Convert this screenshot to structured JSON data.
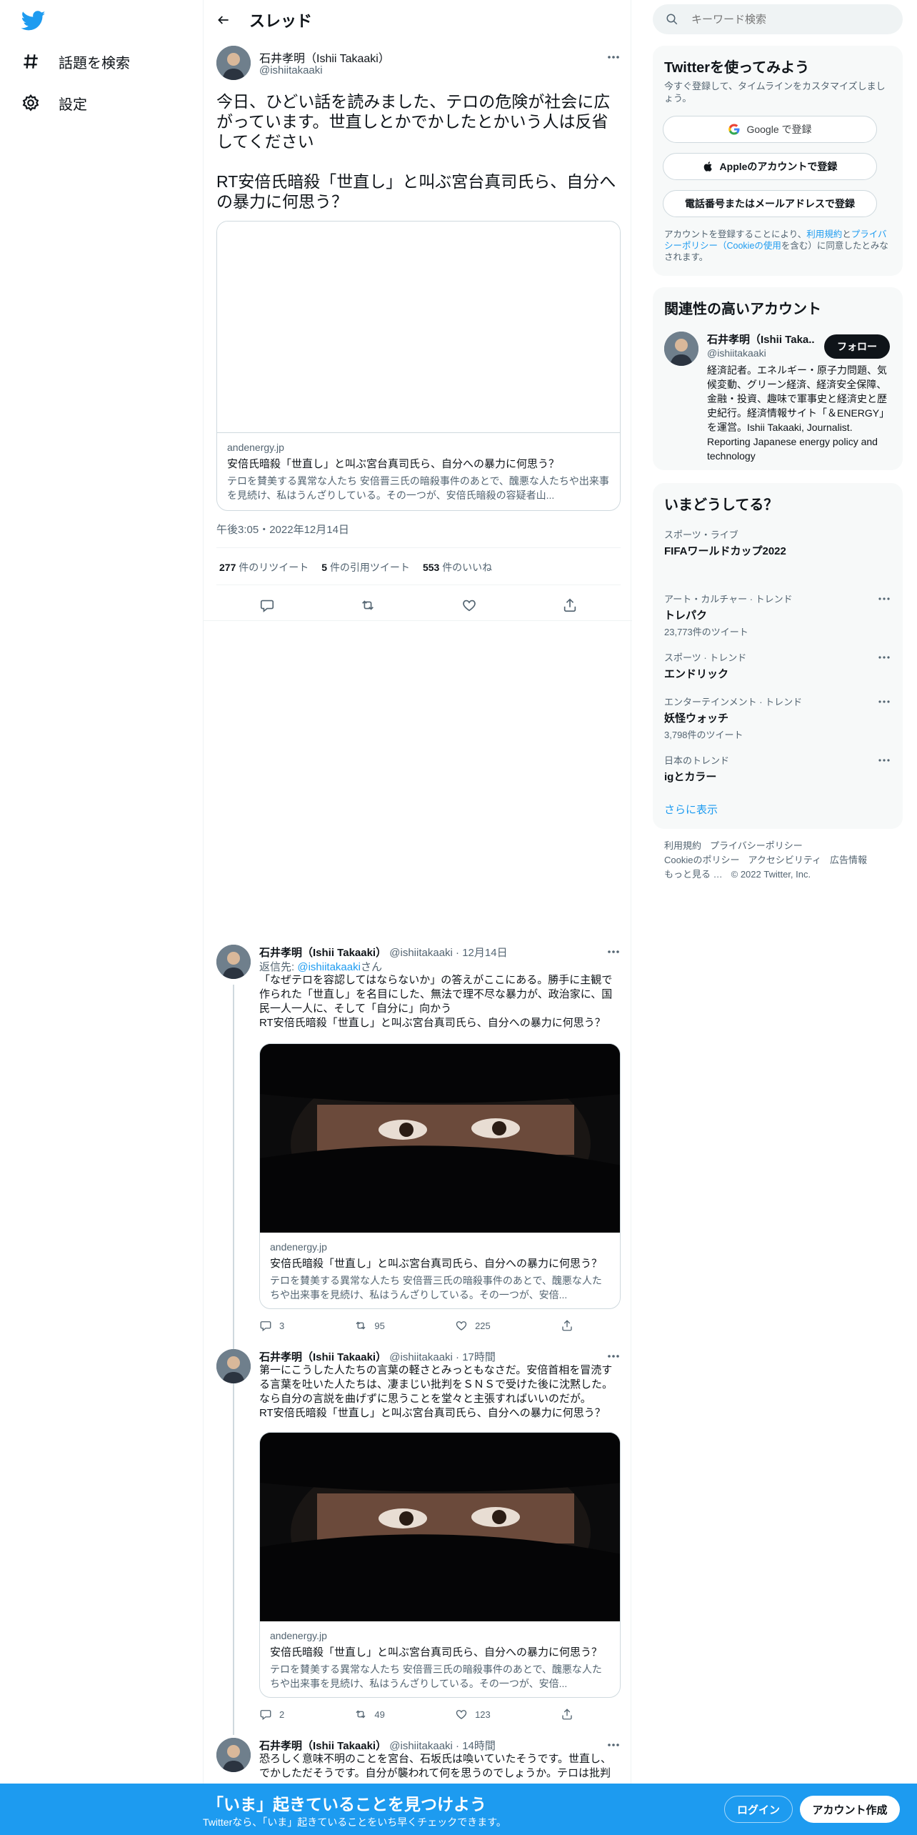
{
  "nav": {
    "explore": "話題を検索",
    "settings": "設定"
  },
  "header": {
    "title": "スレッド"
  },
  "main_tweet": {
    "name": "石井孝明（Ishii Takaaki）",
    "handle": "@ishiitakaaki",
    "text": "今日、ひどい話を読みました、テロの危険が社会に広がっています。世直しとかでかしたとかいう人は反省してください\n\nRT安倍氏暗殺「世直し」と叫ぶ宮台真司氏ら、自分への暴力に何思う？",
    "card": {
      "domain": "andenergy.jp",
      "title": "安倍氏暗殺「世直し」と叫ぶ宮台真司氏ら、自分への暴力に何思う？",
      "desc": "テロを賛美する異常な人たち 安倍晋三氏の暗殺事件のあとで、醜悪な人たちや出来事を見続け、私はうんざりしている。その一つが、安倍氏暗殺の容疑者山..."
    },
    "timestamp": "午後3:05・2022年12月14日",
    "retweets": "277",
    "retweets_label": "件のリツイート",
    "quotes": "5",
    "quotes_label": "件の引用ツイート",
    "likes": "553",
    "likes_label": "件のいいね"
  },
  "replies": [
    {
      "name": "石井孝明（Ishii Takaaki）",
      "handle": "@ishiitakaaki",
      "time": "12月14日",
      "reply_prefix": "返信先:",
      "reply_to": "@ishiitakaaki",
      "reply_suffix": "さん",
      "text": "「なぜテロを容認してはならないか」の答えがここにある。勝手に主観で作られた「世直し」を名目にした、無法で理不尽な暴力が、政治家に、国民一人一人に、そして「自分に」向かう\nRT安倍氏暗殺「世直し」と叫ぶ宮台真司氏ら、自分への暴力に何思う？",
      "card": {
        "domain": "andenergy.jp",
        "title": "安倍氏暗殺「世直し」と叫ぶ宮台真司氏ら、自分への暴力に何思う？",
        "desc": "テロを賛美する異常な人たち 安倍晋三氏の暗殺事件のあとで、醜悪な人たちや出来事を見続け、私はうんざりしている。その一つが、安倍..."
      },
      "replies": "3",
      "retweets": "95",
      "likes": "225"
    },
    {
      "name": "石井孝明（Ishii Takaaki）",
      "handle": "@ishiitakaaki",
      "time": "17時間",
      "text": "第一にこうした人たちの言葉の軽さとみっともなさだ。安倍首相を冒涜する言葉を吐いた人たちは、凄まじい批判をＳＮＳで受けた後に沈黙した。なら自分の言説を曲げずに思うことを堂々と主張すればいいのだが。\nRT安倍氏暗殺「世直し」と叫ぶ宮台真司氏ら、自分への暴力に何思う？",
      "card": {
        "domain": "andenergy.jp",
        "title": "安倍氏暗殺「世直し」と叫ぶ宮台真司氏ら、自分への暴力に何思う？",
        "desc": "テロを賛美する異常な人たち 安倍晋三氏の暗殺事件のあとで、醜悪な人たちや出来事を見続け、私はうんざりしている。その一つが、安倍..."
      },
      "replies": "2",
      "retweets": "49",
      "likes": "123"
    },
    {
      "name": "石井孝明（Ishii Takaaki）",
      "handle": "@ishiitakaaki",
      "time": "14時間",
      "text": "恐ろしく意味不明のことを宮台、石坂氏は喚いていたそうです。世直し、でかしただそうです。自分が襲われて何を思うのでしょうか。テロは批判"
    }
  ],
  "search": {
    "placeholder": "キーワード検索"
  },
  "signup": {
    "title": "Twitterを使ってみよう",
    "sub": "今すぐ登録して、タイムラインをカスタマイズしましょう。",
    "google": "Google で登録",
    "apple": "Appleのアカウントで登録",
    "phone": "電話番号またはメールアドレスで登録",
    "legal_1": "アカウントを登録することにより、",
    "legal_terms": "利用規約",
    "legal_2": "と",
    "legal_privacy": "プライバシーポリシー（Cookieの使用",
    "legal_3": "を含む）に同意したとみなされます。"
  },
  "relevant": {
    "title": "関連性の高いアカウント",
    "name": "石井孝明（Ishii Taka...",
    "handle": "@ishiitakaaki",
    "follow": "フォロー",
    "bio": "経済記者。エネルギー・原子力問題、気候変動、グリーン経済、経済安全保障、金融・投資、趣味で軍事史と経済史と歴史紀行。経済情報サイト「＆ENERGY」を運営。Ishii Takaaki, Journalist. Reporting Japanese energy policy and technology"
  },
  "trends": {
    "title": "いまどうしてる？",
    "items": [
      {
        "kind": "スポーツ・ライブ",
        "name": "FIFAワールドカップ2022",
        "count": ""
      },
      {
        "kind": "アート・カルチャー · トレンド",
        "name": "トレパク",
        "count": "23,773件のツイート"
      },
      {
        "kind": "スポーツ · トレンド",
        "name": "エンドリック",
        "count": ""
      },
      {
        "kind": "エンターテインメント · トレンド",
        "name": "妖怪ウォッチ",
        "count": "3,798件のツイート"
      },
      {
        "kind": "日本のトレンド",
        "name": "igとカラー",
        "count": ""
      }
    ],
    "more": "さらに表示"
  },
  "footer": {
    "l1a": "利用規約",
    "l1b": "プライバシーポリシー",
    "l2a": "Cookieのポリシー",
    "l2b": "アクセシビリティ",
    "l2c": "広告情報",
    "l3a": "もっと見る …",
    "l3b": "© 2022 Twitter, Inc."
  },
  "bottom": {
    "title": "「いま」起きていることを見つけよう",
    "sub": "Twitterなら、「いま」起きていることをいち早くチェックできます。",
    "login": "ログイン",
    "signup": "アカウント作成"
  },
  "colors": {
    "accent": "#1d9bf0",
    "text": "#0f1419",
    "muted": "#536471"
  }
}
